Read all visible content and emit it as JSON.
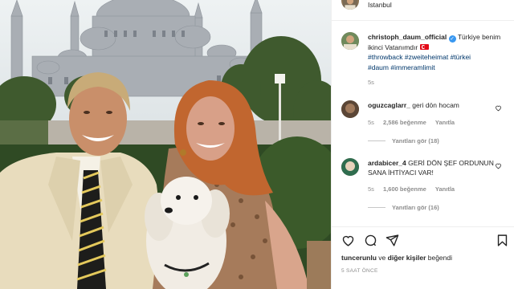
{
  "header": {
    "location": "Istanbul"
  },
  "post": {
    "username": "christoph_daum_official",
    "caption_text": "Türkiye benim ikinci Vatanımdır",
    "hashtags": [
      "#throwback",
      "#zweiteheimat",
      "#türkei",
      "#daum",
      "#immeramlimit"
    ],
    "time": "5s",
    "flag_icon": "turkey-flag-icon",
    "verified_icon": "verified-badge-icon"
  },
  "comments": [
    {
      "username": "oguzcaglarr_",
      "text": "geri dön hocam",
      "time": "5s",
      "likes": "2,586 beğenme",
      "reply": "Yanıtla",
      "view_replies": "Yanıtları gör (18)"
    },
    {
      "username": "ardabicer_4",
      "text": "GERİ DÖN ŞEF ORDUNUN SANA İHTİYACI VAR!",
      "time": "5s",
      "likes": "1,600 beğenme",
      "reply": "Yanıtla",
      "view_replies": "Yanıtları gör (16)"
    }
  ],
  "actions": {
    "icons": [
      "heart-icon",
      "comment-icon",
      "share-icon",
      "bookmark-icon"
    ]
  },
  "likes_line": {
    "user": "tuncerunlu",
    "connector": "ve",
    "others": "diğer kişiler",
    "suffix": "beğendi"
  },
  "post_time": "5 SAAT ÖNCE",
  "colors": {
    "link_blue": "#00376b",
    "muted": "#8e8e8e",
    "verified": "#3897f0",
    "flag_red": "#e30a17"
  }
}
